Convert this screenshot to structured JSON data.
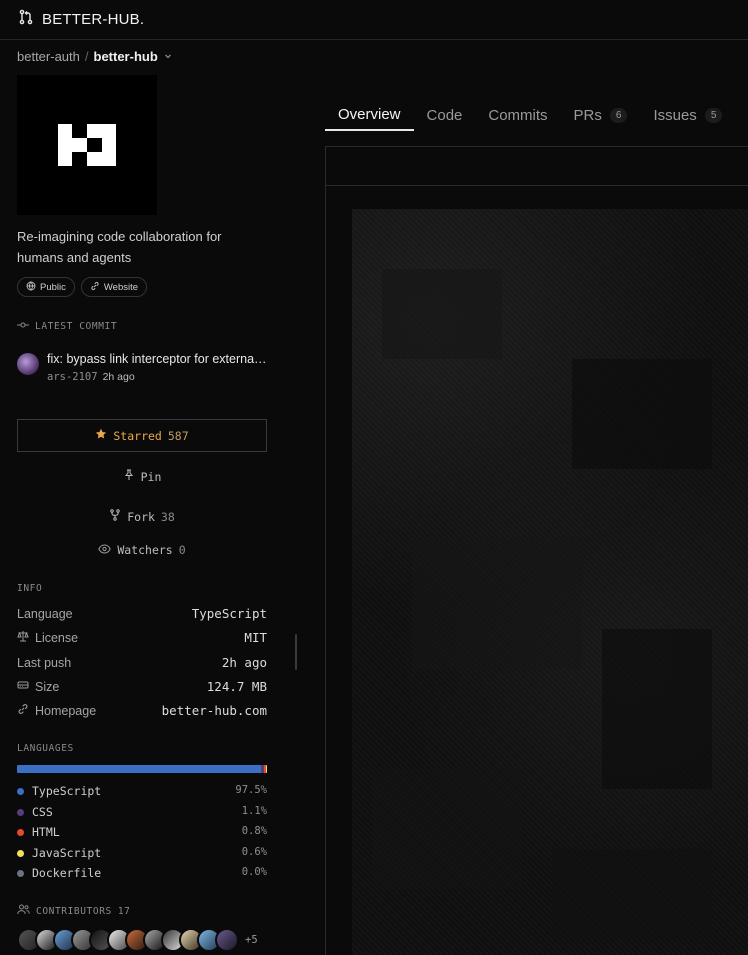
{
  "brand": {
    "name": "BETTER-HUB.",
    "icon": "git-pull-icon"
  },
  "breadcrumb": {
    "owner": "better-auth",
    "separator": "/",
    "repo": "better-hub",
    "icon": "chevron-down-icon"
  },
  "repo": {
    "description": "Re-imagining code collaboration for humans and agents",
    "chips": [
      {
        "label": "Public",
        "icon": "globe-icon"
      },
      {
        "label": "Website",
        "icon": "link-icon"
      }
    ]
  },
  "latest_commit": {
    "label": "LATEST COMMIT",
    "message": "fix: bypass link interceptor for external links",
    "author": "ars-2107",
    "time": "2h ago"
  },
  "actions": {
    "star": {
      "label": "Starred",
      "count": "587",
      "icon": "star-icon"
    },
    "pin": {
      "label": "Pin",
      "icon": "pin-icon"
    },
    "fork": {
      "label": "Fork",
      "count": "38",
      "icon": "fork-icon"
    },
    "watchers": {
      "label": "Watchers",
      "count": "0",
      "icon": "eye-icon"
    }
  },
  "info": {
    "label": "INFO",
    "rows": [
      {
        "key": "Language",
        "value": "TypeScript",
        "icon": ""
      },
      {
        "key": "License",
        "value": "MIT",
        "icon": "scale-icon"
      },
      {
        "key": "Last push",
        "value": "2h ago",
        "icon": ""
      },
      {
        "key": "Size",
        "value": "124.7 MB",
        "icon": "drive-icon"
      },
      {
        "key": "Homepage",
        "value": "better-hub.com",
        "icon": "link-icon"
      }
    ]
  },
  "languages": {
    "label": "LANGUAGES",
    "items": [
      {
        "name": "TypeScript",
        "percent": "97.5%",
        "share": 97.5,
        "color": "#3a6fc4"
      },
      {
        "name": "CSS",
        "percent": "1.1%",
        "share": 1.1,
        "color": "#563d7c"
      },
      {
        "name": "HTML",
        "percent": "0.8%",
        "share": 0.8,
        "color": "#e34c26"
      },
      {
        "name": "JavaScript",
        "percent": "0.6%",
        "share": 0.6,
        "color": "#f1e05a"
      },
      {
        "name": "Dockerfile",
        "percent": "0.0%",
        "share": 0.0,
        "color": "#6b7280"
      }
    ]
  },
  "contributors": {
    "label": "CONTRIBUTORS",
    "count": "17",
    "more": "+5",
    "icon": "users-icon"
  },
  "tabs": [
    {
      "label": "Overview",
      "active": true,
      "badge": ""
    },
    {
      "label": "Code",
      "active": false,
      "badge": ""
    },
    {
      "label": "Commits",
      "active": false,
      "badge": ""
    },
    {
      "label": "PRs",
      "active": false,
      "badge": "6"
    },
    {
      "label": "Issues",
      "active": false,
      "badge": "5"
    }
  ]
}
